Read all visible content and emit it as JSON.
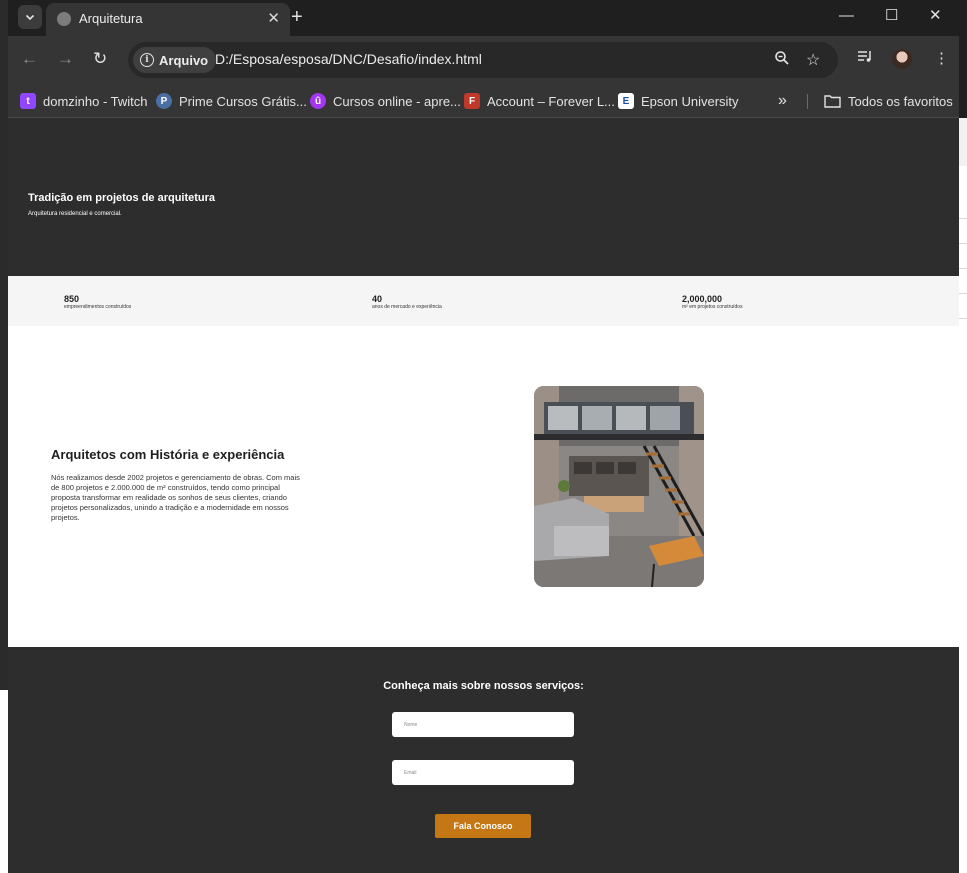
{
  "browser": {
    "tab_title": "Arquitetura",
    "security_chip": "Arquivo",
    "url": "D:/Esposa/esposa/DNC/Desafio/index.html"
  },
  "bookmarks": [
    {
      "label": "domzinho - Twitch",
      "icon": "twitch-icon",
      "color": "#9146ff"
    },
    {
      "label": "Prime Cursos Grátis...",
      "icon": "prime-cursos-icon",
      "color": "#4a6fa5"
    },
    {
      "label": "Cursos online - apre...",
      "icon": "udemy-icon",
      "color": "#a435f0"
    },
    {
      "label": "Account – Forever L...",
      "icon": "forever-icon",
      "color": "#c0392b"
    },
    {
      "label": "Epson University",
      "icon": "epson-icon",
      "color": "#1b4ea3"
    }
  ],
  "bookmarks_overflow": "»",
  "all_bookmarks": "Todos os favoritos",
  "hero": {
    "title": "Tradição em projetos de arquitetura",
    "subtitle": "Arquitetura residencial e comercial."
  },
  "stats": [
    {
      "value": "850",
      "label": "empreendimentos construídos"
    },
    {
      "value": "40",
      "label": "anos de mercado e experiência"
    },
    {
      "value": "2,000,000",
      "label": "m² em projetos construídos"
    }
  ],
  "about": {
    "title": "Arquitetos com História e experiência",
    "text": "Nós realizamos desde 2002 projetos e gerenciamento de obras. Com mais de 800 projetos e 2.000.000 de m² construídos, tendo como principal proposta transformar em realidade os sonhos de seus clientes, criando projetos personalizados, unindo a tradição e a modernidade em nossos projetos."
  },
  "contact": {
    "title": "Conheça mais sobre nossos serviços:",
    "name_placeholder": "Nome",
    "email_placeholder": "Email",
    "button": "Fala Conosco"
  },
  "colors": {
    "dark_bg": "#2d2d2d",
    "accent": "#c47714"
  }
}
